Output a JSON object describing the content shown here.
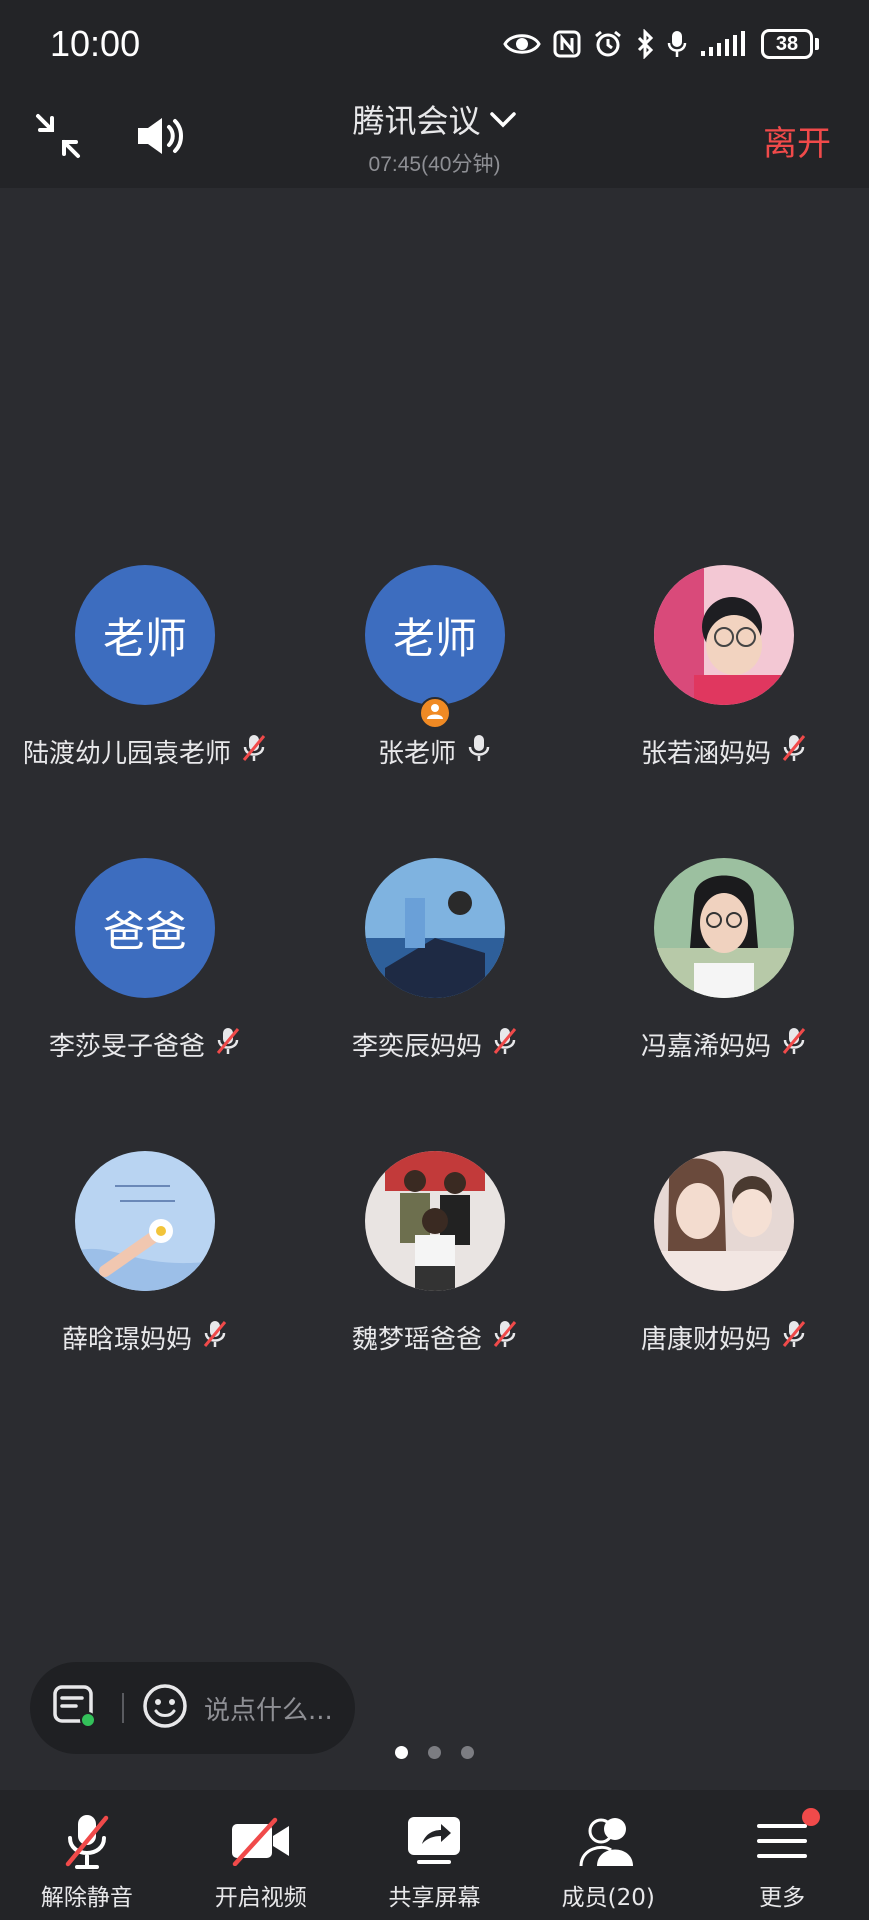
{
  "status_bar": {
    "time": "10:00",
    "battery": "38"
  },
  "header": {
    "title": "腾讯会议",
    "subtitle": "07:45(40分钟)",
    "leave_label": "离开"
  },
  "participants": [
    {
      "avatar_text": "老师",
      "name": "陆渡幼儿园袁老师",
      "mic": "muted",
      "avatar_kind": "text"
    },
    {
      "avatar_text": "老师",
      "name": "张老师",
      "mic": "on",
      "avatar_kind": "text",
      "host": true
    },
    {
      "name": "张若涵妈妈",
      "mic": "muted",
      "avatar_kind": "photo"
    },
    {
      "avatar_text": "爸爸",
      "name": "李莎旻子爸爸",
      "mic": "muted",
      "avatar_kind": "text"
    },
    {
      "name": "李奕辰妈妈",
      "mic": "muted",
      "avatar_kind": "photo"
    },
    {
      "name": "冯嘉浠妈妈",
      "mic": "muted",
      "avatar_kind": "photo"
    },
    {
      "name": "薛晗璟妈妈",
      "mic": "muted",
      "avatar_kind": "photo"
    },
    {
      "name": "魏梦瑶爸爸",
      "mic": "muted",
      "avatar_kind": "photo"
    },
    {
      "name": "唐康财妈妈",
      "mic": "muted",
      "avatar_kind": "photo"
    }
  ],
  "chat": {
    "placeholder": "说点什么..."
  },
  "pagination": {
    "pages": 3,
    "current": 1
  },
  "toolbar": {
    "unmute_label": "解除静音",
    "video_label": "开启视频",
    "share_label": "共享屏幕",
    "members_label": "成员(20)",
    "more_label": "更多"
  },
  "colors": {
    "background": "#2b2c30",
    "bar": "#232427",
    "avatar_blue": "#3d6dbf",
    "leave_red": "#f04a4a",
    "host_orange": "#f08a24"
  }
}
